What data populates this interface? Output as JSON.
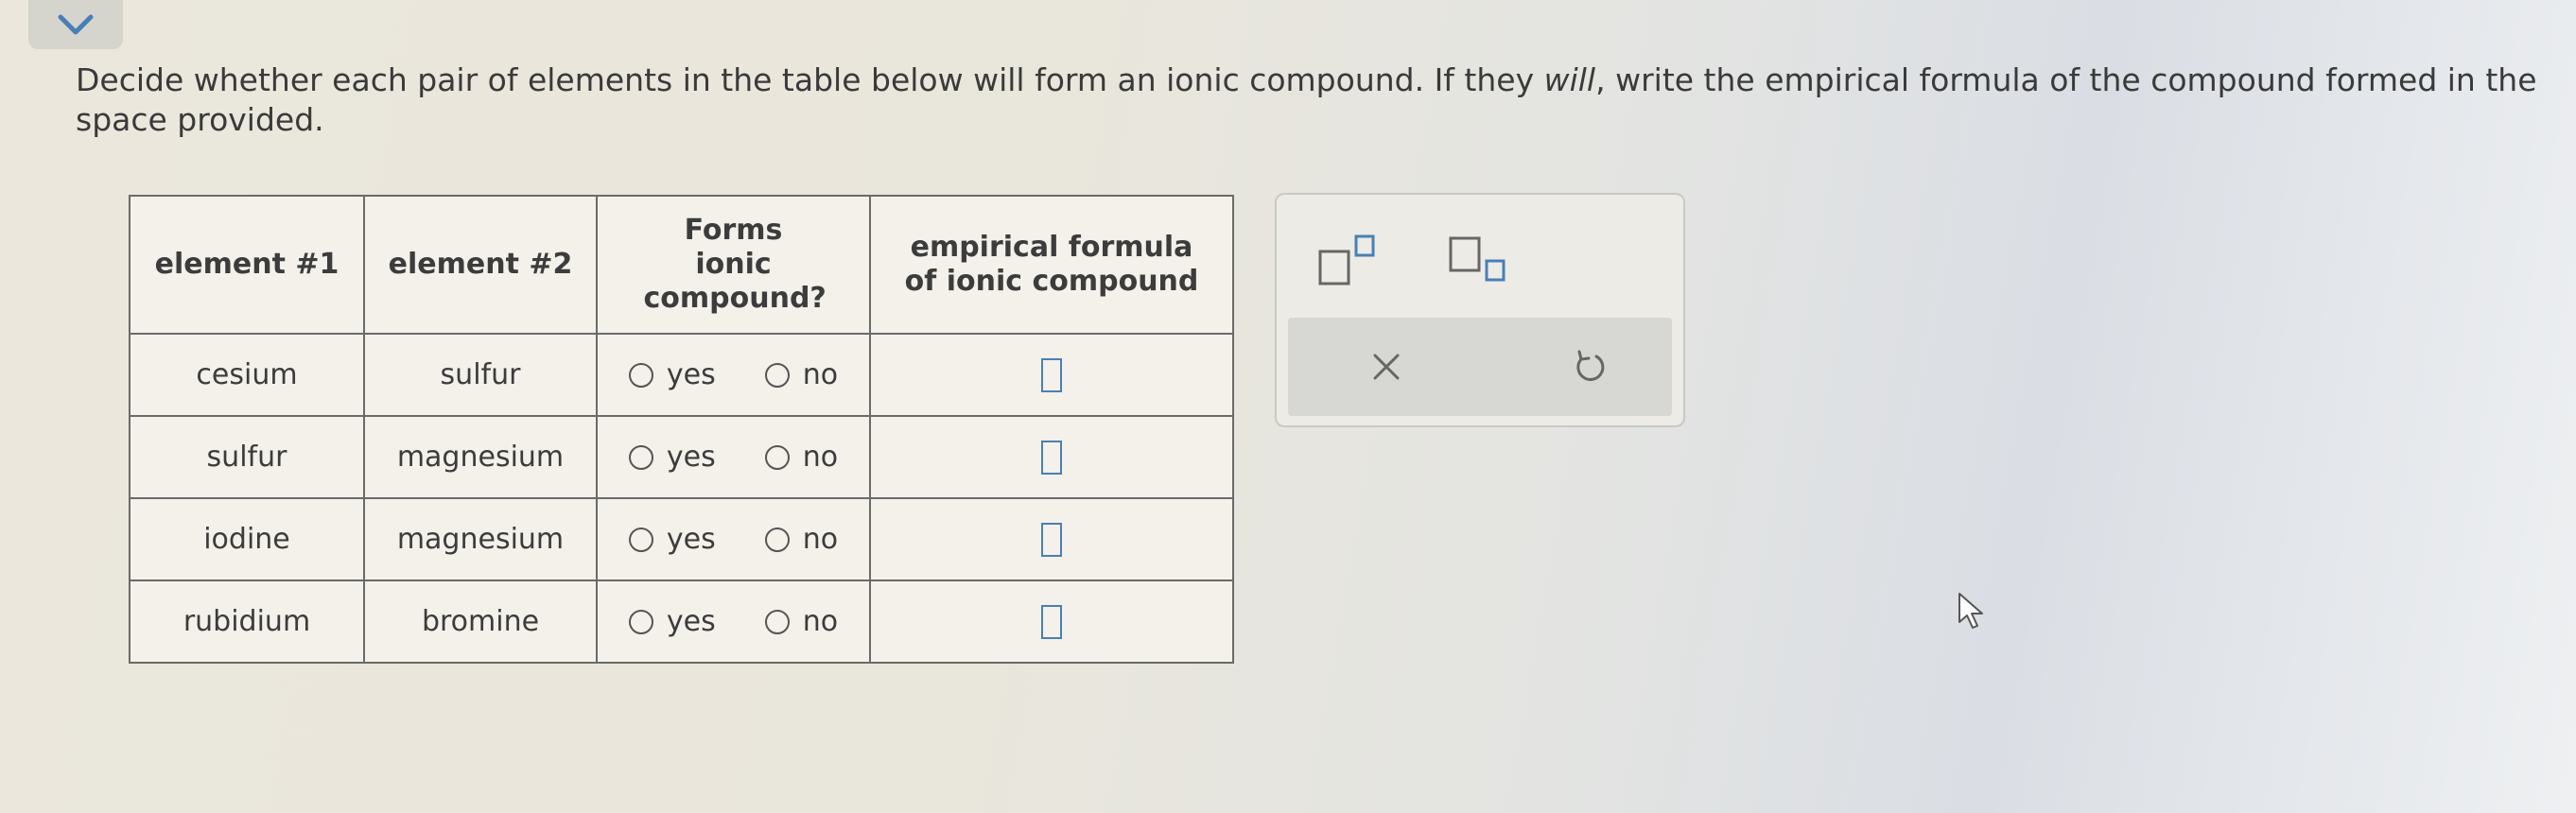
{
  "instructions": {
    "part1": "Decide whether each pair of elements in the table below will form an ionic compound. If they ",
    "emphasis": "will",
    "part2": ", write the empirical formula of the compound formed in the space provided."
  },
  "table": {
    "headers": {
      "element1": "element #1",
      "element2": "element #2",
      "forms_ionic": "Forms ionic compound?",
      "formula": "empirical formula of ionic compound"
    },
    "option_yes": "yes",
    "option_no": "no",
    "rows": [
      {
        "element1": "cesium",
        "element2": "sulfur"
      },
      {
        "element1": "sulfur",
        "element2": "magnesium"
      },
      {
        "element1": "iodine",
        "element2": "magnesium"
      },
      {
        "element1": "rubidium",
        "element2": "bromine"
      }
    ]
  },
  "tools": {
    "superscript_icon": "superscript-icon",
    "subscript_icon": "subscript-icon",
    "clear_icon": "close-icon",
    "undo_icon": "undo-icon"
  },
  "colors": {
    "input_box": "#4a7fb5",
    "chevron": "#4a7fb5"
  }
}
